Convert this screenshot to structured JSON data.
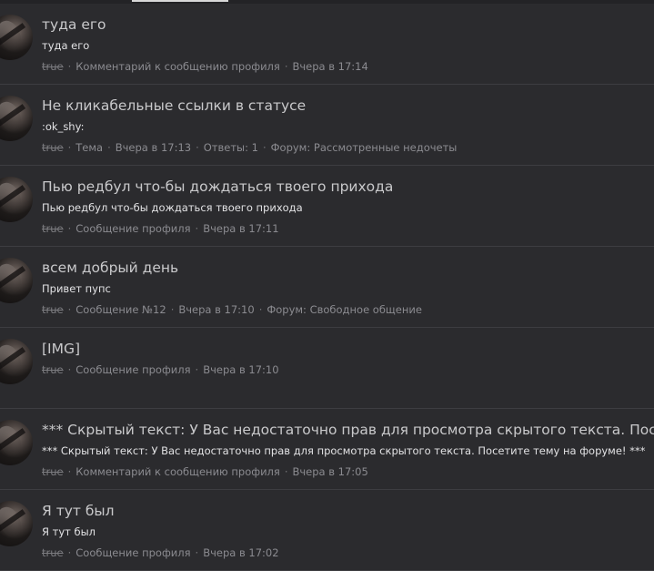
{
  "feed": {
    "items": [
      {
        "title": "туда его",
        "snippet": "туда его",
        "meta": [
          "true",
          "Комментарий к сообщению профиля",
          "Вчера в 17:14"
        ]
      },
      {
        "title": "Не кликабельные ссылки в статусе",
        "snippet": ":ok_shy:",
        "meta": [
          "true",
          "Тема",
          "Вчера в 17:13",
          "Ответы: 1",
          "Форум: Рассмотренные недочеты"
        ]
      },
      {
        "title": "Пью редбул что-бы дождаться твоего прихода",
        "snippet": "Пью редбул что-бы дождаться твоего прихода",
        "meta": [
          "true",
          "Сообщение профиля",
          "Вчера в 17:11"
        ]
      },
      {
        "title": "всем добрый день",
        "snippet": "Привет пупс",
        "meta": [
          "true",
          "Сообщение №12",
          "Вчера в 17:10",
          "Форум: Свободное общение"
        ]
      },
      {
        "title": "[IMG]",
        "snippet": "",
        "meta": [
          "true",
          "Сообщение профиля",
          "Вчера в 17:10"
        ]
      },
      {
        "title": "*** Скрытый текст: У Вас недостаточно прав для просмотра скрытого текста. Посетите тему на форуме! ***",
        "snippet": "*** Скрытый текст: У Вас недостаточно прав для просмотра скрытого текста. Посетите тему на форуме! ***",
        "meta": [
          "true",
          "Комментарий к сообщению профиля",
          "Вчера в 17:05"
        ]
      },
      {
        "title": "Я тут был",
        "snippet": "Я тут был",
        "meta": [
          "true",
          "Сообщение профиля",
          "Вчера в 17:02"
        ]
      }
    ]
  }
}
